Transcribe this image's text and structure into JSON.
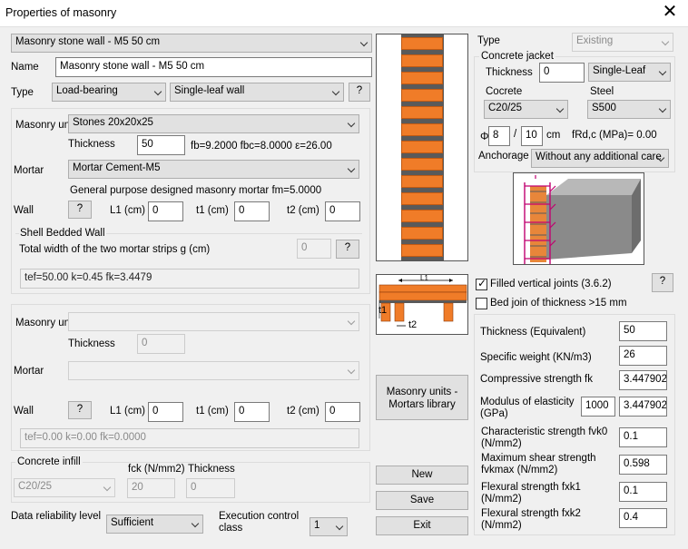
{
  "window": {
    "title": "Properties of masonry"
  },
  "top": {
    "wall_select": "Masonry stone wall - M5 50 cm",
    "name_label": "Name",
    "name_value": "Masonry stone wall - M5 50 cm",
    "type_label": "Type",
    "type_select": "Load-bearing",
    "type2_select": "Single-leaf wall",
    "help": "?"
  },
  "masonry1": {
    "unit_label": "Masonry uni",
    "unit_select": "Stones 20x20x25",
    "thickness_label": "Thickness",
    "thickness_value": "50",
    "fb_text": "fb=9.2000 fbc=8.0000 ε=26.00",
    "mortar_label": "Mortar",
    "mortar_select": "Mortar Cement-M5",
    "mortar_desc": "General purpose designed masonry mortar fm=5.0000",
    "wall_label": "Wall",
    "help": "?",
    "l1_label": "L1 (cm)",
    "l1_value": "0",
    "t1_label": "t1 (cm)",
    "t1_value": "0",
    "t2_label": "t2 (cm)",
    "t2_value": "0",
    "shell_label": "Shell Bedded Wall",
    "shell_desc": "Total width of the two mortar strips g (cm)",
    "g_value": "0",
    "g_help": "?",
    "result": "tef=50.00 k=0.45 fk=3.4479"
  },
  "masonry2": {
    "unit_label": "Masonry uni",
    "unit_select": "",
    "thickness_label": "Thickness",
    "thickness_value": "0",
    "mortar_label": "Mortar",
    "mortar_select": "",
    "wall_label": "Wall",
    "help": "?",
    "l1_label": "L1 (cm)",
    "l1_value": "0",
    "t1_label": "t1 (cm)",
    "t1_value": "0",
    "t2_label": "t2 (cm)",
    "t2_value": "0",
    "result": "tef=0.00 k=0.00 fk=0.0000"
  },
  "infill": {
    "label": "Concrete infill",
    "select": "C20/25",
    "fck_label": "fck (N/mm2)",
    "fck_value": "20",
    "thickness_label": "Thickness",
    "thickness_value": "0"
  },
  "bottom": {
    "reliability_label": "Data reliability level",
    "reliability_select": "Sufficient",
    "exec_label_1": "Execution control",
    "exec_label_2": "class",
    "exec_select": "1"
  },
  "diagram_labels": {
    "l1": "L1",
    "t1": "t1",
    "t2": "t2"
  },
  "buttons": {
    "library_1": "Masonry units -",
    "library_2": "Mortars library",
    "new": "New",
    "save": "Save",
    "exit": "Exit"
  },
  "jacket": {
    "type_label": "Type",
    "type_select": "Existing",
    "group_label": "Concrete jacket",
    "thickness_label": "Thickness",
    "thickness_value": "0",
    "leaf_select": "Single-Leaf",
    "concrete_label": "Cocrete",
    "concrete_select": "C20/25",
    "steel_label": "Steel",
    "steel_select": "S500",
    "phi_label": "Φ",
    "phi_value": "8",
    "slash": "/",
    "spacing_value": "10",
    "cm_label": "cm",
    "frd_text": "fRd,c (MPa)=  0.00",
    "anchorage_label": "Anchorage",
    "anchorage_select": "Without any additional care"
  },
  "checks": {
    "filled_label": "Filled vertical joints (3.6.2)",
    "filled_checked": true,
    "help": "?",
    "bed_label": "Bed join of thickness >15 mm",
    "bed_checked": false
  },
  "props": {
    "thickness_label": "Thickness (Equivalent)",
    "thickness_value": "50",
    "weight_label": "Specific weight (KN/m3)",
    "weight_value": "26",
    "fk_label": "Compressive strength fk",
    "fk_value": "3.447902",
    "modulus_label_1": "Modulus of elasticity",
    "modulus_label_2": "(GPa)",
    "modulus_factor": "1000",
    "modulus_value": "3.447902",
    "fvk0_label_1": "Characteristic strength  fvk0",
    "fvk0_label_2": "(N/mm2)",
    "fvk0_value": "0.1",
    "fvkmax_label_1": "Maximum shear strength",
    "fvkmax_label_2": "fvkmax (N/mm2)",
    "fvkmax_value": "0.598",
    "fxk1_label_1": "Flexural strength  fxk1",
    "fxk1_label_2": "(N/mm2)",
    "fxk1_value": "0.1",
    "fxk2_label_1": "Flexural strength  fxk2",
    "fxk2_label_2": "(N/mm2)",
    "fxk2_value": "0.4"
  }
}
